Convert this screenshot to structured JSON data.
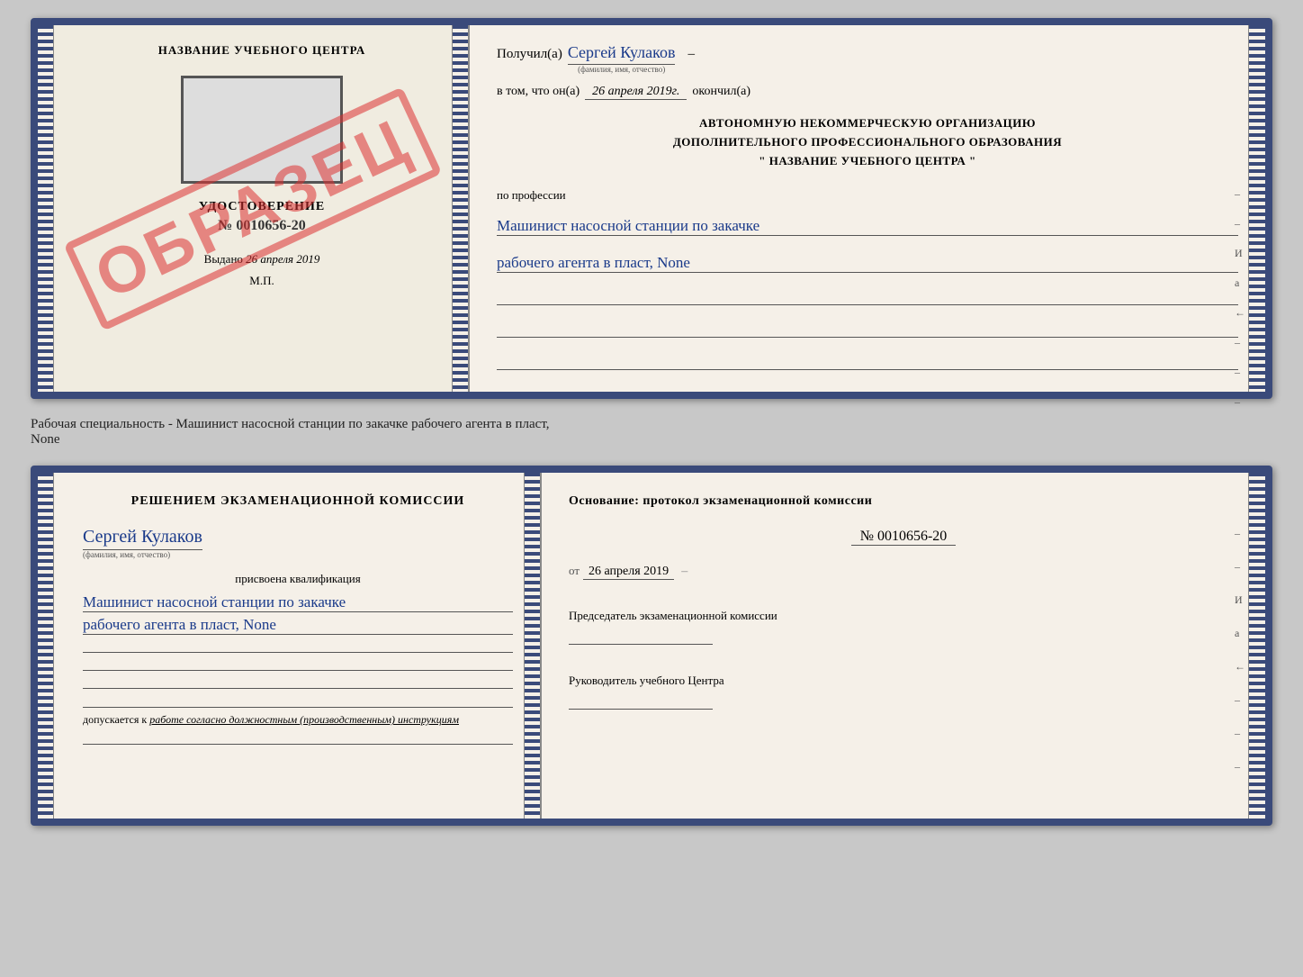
{
  "top_doc": {
    "left": {
      "center_title": "НАЗВАНИЕ УЧЕБНОГО ЦЕНТРА",
      "sample_stamp": "ОБРАЗЕЦ",
      "cert_label": "УДОСТОВЕРЕНИЕ",
      "cert_number": "№ 0010656-20",
      "vydano_label": "Выдано",
      "vydano_date": "26 апреля 2019",
      "mp_label": "М.П."
    },
    "right": {
      "poluchil_label": "Получил(а)",
      "poluchil_name": "Сергей Кулаков",
      "name_hint": "(фамилия, имя, отчество)",
      "vtom_label": "в том, что он(а)",
      "vtom_date": "26 апреля 2019г.",
      "okonchil_label": "окончил(а)",
      "org_line1": "АВТОНОМНУЮ НЕКОММЕРЧЕСКУЮ ОРГАНИЗАЦИЮ",
      "org_line2": "ДОПОЛНИТЕЛЬНОГО ПРОФЕССИОНАЛЬНОГО ОБРАЗОВАНИЯ",
      "org_line3": "\" НАЗВАНИЕ УЧЕБНОГО ЦЕНТРА \"",
      "po_professii": "по профессии",
      "profession_line1": "Машинист насосной станции по закачке",
      "profession_line2": "рабочего агента в пласт, None"
    }
  },
  "between_text": "Рабочая специальность - Машинист насосной станции по закачке рабочего агента в пласт,",
  "between_text2": "None",
  "bottom_doc": {
    "left": {
      "resheniem_label": "Решением экзаменационной комиссии",
      "person_name": "Сергей Кулаков",
      "name_hint": "(фамилия, имя, отчество)",
      "prisvoyena_label": "присвоена квалификация",
      "profession_line1": "Машинист насосной станции по закачке",
      "profession_line2": "рабочего агента в пласт, None",
      "dopuskaetsya_prefix": "допускается к",
      "dopuskaetsya_text": "работе согласно должностным (производственным) инструкциям"
    },
    "right": {
      "osnov_label": "Основание: протокол экзаменационной комиссии",
      "protocol_number": "№ 0010656-20",
      "ot_label": "от",
      "ot_date": "26 апреля 2019",
      "predsedatel_label": "Председатель экзаменационной комиссии",
      "rukovoditel_label": "Руководитель учебного Центра"
    }
  }
}
